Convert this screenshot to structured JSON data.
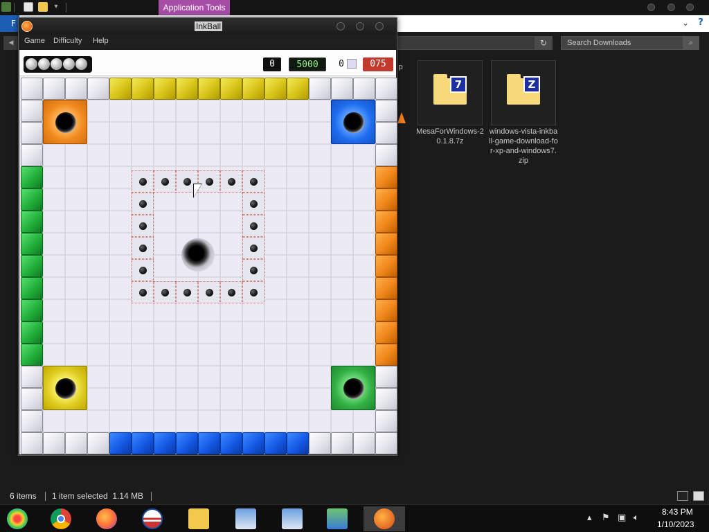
{
  "explorer": {
    "ribbon_context_tab": "Application Tools",
    "file_tab": "F",
    "search_placeholder": "Search Downloads",
    "partial_label": "p",
    "files": [
      {
        "name": "MesaForWindows-20.1.8.7z",
        "badge": "7"
      },
      {
        "name": "windows-vista-inkball-game-download-for-xp-and-windows7.zip",
        "badge": "Z"
      }
    ],
    "status": {
      "items": "6 items",
      "selected": "1 item selected  1.14 MB"
    }
  },
  "inkball": {
    "title": "InkBall",
    "menu": [
      "Game",
      "Difficulty",
      "Help"
    ],
    "balls_remaining": "0",
    "score": "5000",
    "misses": "0",
    "timer": "075",
    "tray_ball_count": 5
  },
  "board": {
    "grid_size": 17,
    "goals": [
      {
        "color": "orange",
        "position": "top-left"
      },
      {
        "color": "blue",
        "position": "top-right"
      },
      {
        "color": "yellow",
        "position": "bottom-left"
      },
      {
        "color": "green",
        "position": "bottom-right"
      }
    ],
    "walls": {
      "top": [
        "gray",
        "gray",
        "gray",
        "gray",
        "yellow",
        "yellow",
        "yellow",
        "yellow",
        "yellow",
        "yellow",
        "yellow",
        "yellow",
        "yellow",
        "gray",
        "gray",
        "gray",
        "gray"
      ],
      "bottom": [
        "gray",
        "gray",
        "gray",
        "gray",
        "blue",
        "blue",
        "blue",
        "blue",
        "blue",
        "blue",
        "blue",
        "blue",
        "blue",
        "gray",
        "gray",
        "gray",
        "gray"
      ],
      "left": [
        "gray",
        "gray",
        "gray",
        "gray",
        "green",
        "green",
        "green",
        "green",
        "green",
        "green",
        "green",
        "green",
        "green",
        "gray",
        "gray",
        "gray",
        "gray"
      ],
      "right": [
        "gray",
        "gray",
        "gray",
        "gray",
        "orange",
        "orange",
        "orange",
        "orange",
        "orange",
        "orange",
        "orange",
        "orange",
        "orange",
        "gray",
        "gray",
        "gray",
        "gray"
      ]
    },
    "center_hole": "gray"
  },
  "taskbar": {
    "apps": [
      "chrome",
      "firefox",
      "obama-logo",
      "file-explorer",
      "setup-installer-1",
      "setup-installer-2",
      "network-app",
      "inkball"
    ],
    "active_app": "inkball",
    "clock_time": "8:43 PM",
    "clock_date": "1/10/2023"
  }
}
